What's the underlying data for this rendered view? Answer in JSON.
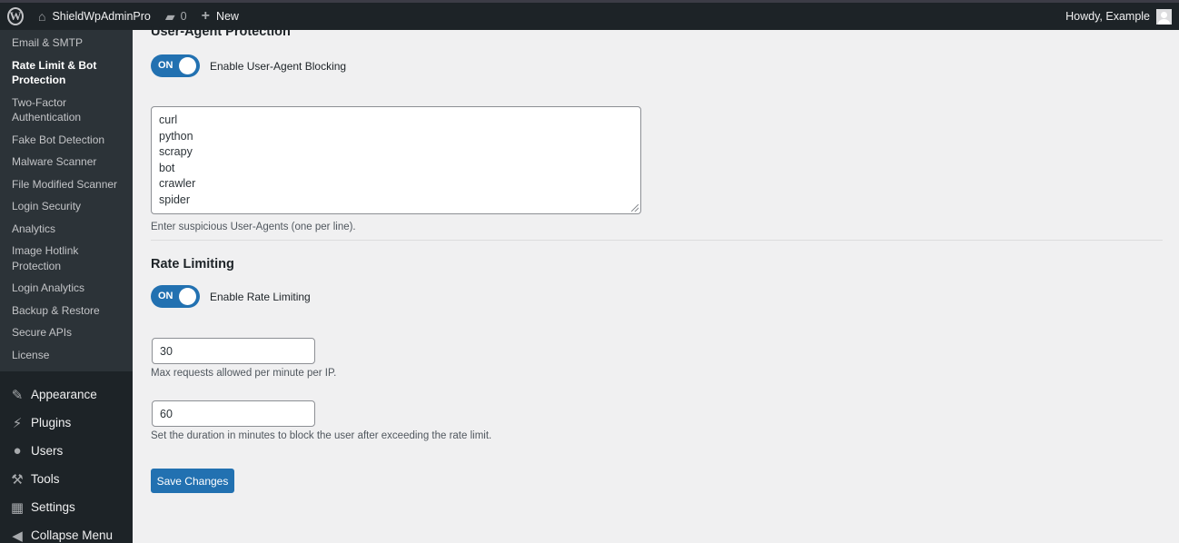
{
  "adminbar": {
    "site_name": "ShieldWpAdminPro",
    "comments_count": "0",
    "new_label": "New",
    "howdy": "Howdy, Example"
  },
  "sidebar": {
    "submenu": [
      {
        "label": "Email & SMTP"
      },
      {
        "label": "Rate Limit & Bot Protection",
        "current": true
      },
      {
        "label": "Two-Factor Authentication"
      },
      {
        "label": "Fake Bot Detection"
      },
      {
        "label": "Malware Scanner"
      },
      {
        "label": "File Modified Scanner"
      },
      {
        "label": "Login Security"
      },
      {
        "label": "Analytics"
      },
      {
        "label": "Image Hotlink Protection"
      },
      {
        "label": "Login Analytics"
      },
      {
        "label": "Backup & Restore"
      },
      {
        "label": "Secure APIs"
      },
      {
        "label": "License"
      }
    ],
    "menu": [
      {
        "label": "Appearance",
        "icon": "paintbrush-icon"
      },
      {
        "label": "Plugins",
        "icon": "plug-icon"
      },
      {
        "label": "Users",
        "icon": "user-icon"
      },
      {
        "label": "Tools",
        "icon": "wrench-icon"
      },
      {
        "label": "Settings",
        "icon": "settings-icon"
      },
      {
        "label": "Collapse Menu",
        "icon": "collapse-icon"
      }
    ]
  },
  "ua_section": {
    "title": "User-Agent Protection",
    "toggle_state": "ON",
    "toggle_label": "Enable User-Agent Blocking",
    "agents": [
      "curl",
      "python",
      "scrapy",
      "bot",
      "crawler",
      "spider"
    ],
    "description": "Enter suspicious User-Agents (one per line)."
  },
  "rate_section": {
    "title": "Rate Limiting",
    "toggle_state": "ON",
    "toggle_label": "Enable Rate Limiting",
    "max_requests": "30",
    "max_requests_desc": "Max requests allowed per minute per IP.",
    "block_duration": "60",
    "block_duration_desc": "Set the duration in minutes to block the user after exceeding the rate limit."
  },
  "save_label": "Save Changes",
  "colors": {
    "accent": "#2271b1",
    "adminbar_bg": "#1d2327",
    "submenu_bg": "#2c3338",
    "content_bg": "#f0f0f1"
  }
}
